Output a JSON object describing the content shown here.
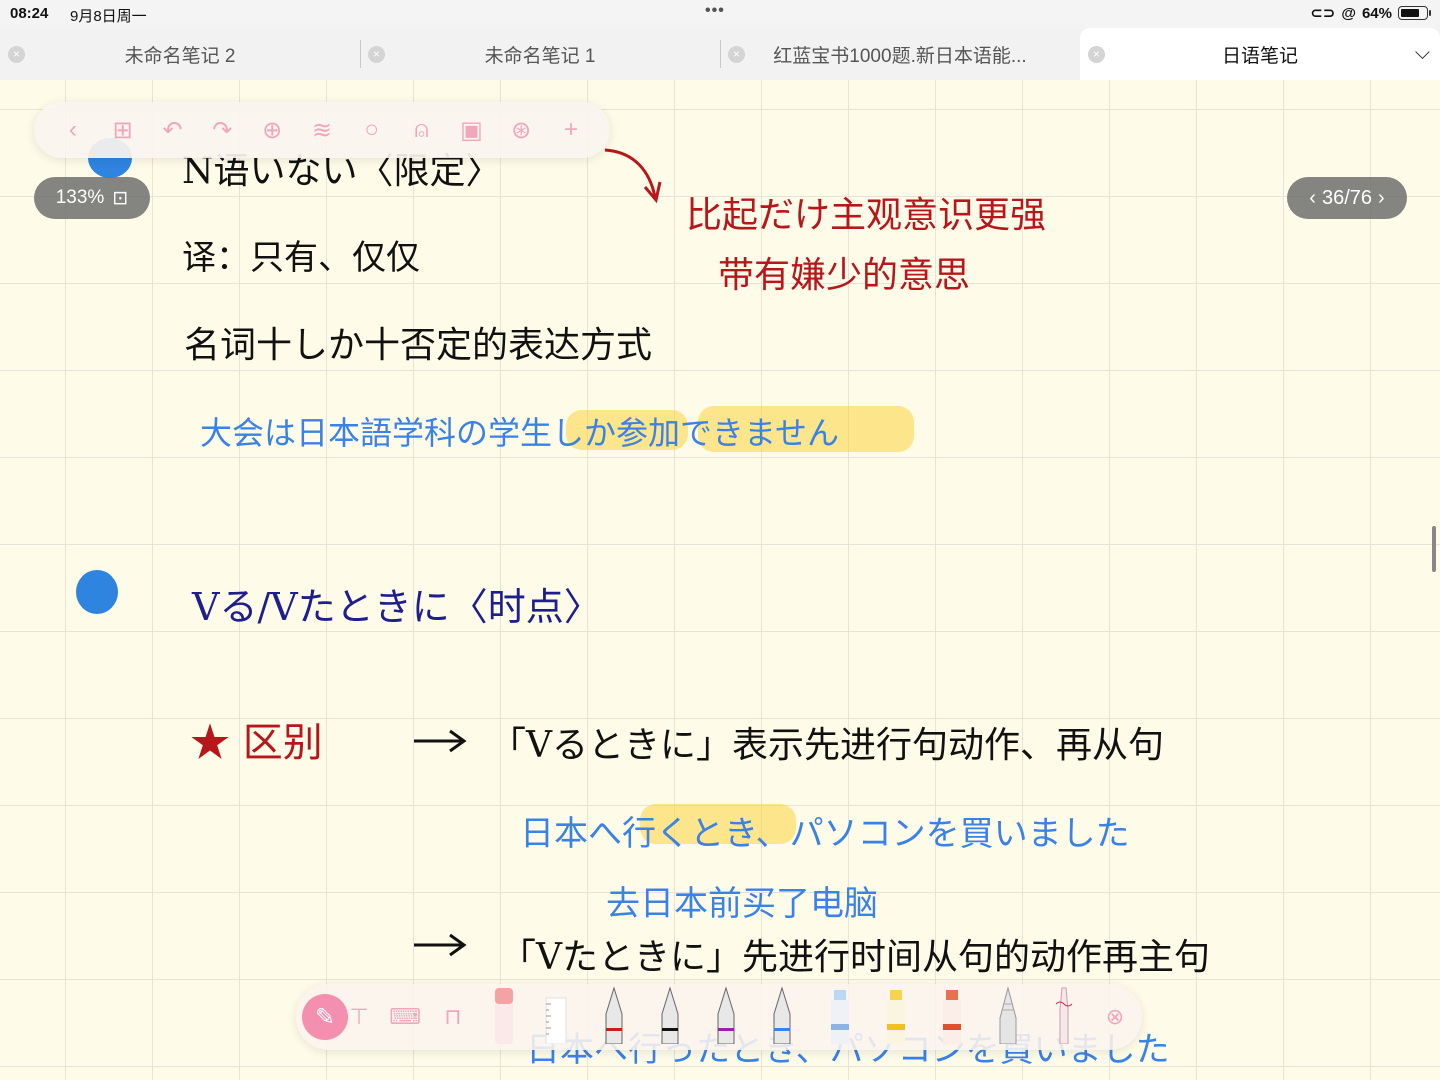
{
  "status_bar": {
    "time": "08:24",
    "date": "9月8日周一",
    "battery": "64%",
    "battery_level": 0.64
  },
  "tabs": [
    {
      "label": "未命名笔记 2",
      "active": false
    },
    {
      "label": "未命名笔记 1",
      "active": false
    },
    {
      "label": "红蓝宝书1000题.新日本语能...",
      "active": false
    },
    {
      "label": "日语笔记",
      "active": true
    }
  ],
  "toolbar_top": {
    "icons": [
      "back-icon",
      "grid-icon",
      "undo-icon",
      "redo-icon",
      "add-page-icon",
      "layers-icon",
      "search-icon",
      "microphone-icon",
      "sticker-icon",
      "globe-icon",
      "plus-icon"
    ]
  },
  "zoom": "133%",
  "page_indicator": "36/76",
  "note": {
    "line_partial_top": "N语いない〈限定〉",
    "translation": "译：只有、仅仅",
    "grammar": "名词十しか十否定的表达方式",
    "example1": "大会は日本語学科の学生しか参加できません",
    "side_note_1": "比起だけ主观意识更强",
    "side_note_2": "带有嫌少的意思",
    "heading2": "Vる/Vたときに〈时点〉",
    "distinction_label": "★ 区别",
    "rule1": "「Vるときに」表示先进行句动作、再从句",
    "example2": "日本へ行くとき、パソコンを買いました",
    "example2_translation": "去日本前买了电脑",
    "rule2": "「Vたときに」先进行时间从句的动作再主句",
    "example3_partial": "日本へ行ったとき、パソコンを買いました"
  },
  "colors": {
    "ink_black": "#111111",
    "ink_red": "#b7161b",
    "ink_blue": "#3b82e6",
    "ink_navy": "#1e1e8c",
    "highlight": "#fad23c",
    "accent_pink": "#f58fb0"
  },
  "toolbar_bottom": {
    "tools": [
      "pen-icon",
      "text-box-icon",
      "keyboard-icon",
      "book-icon",
      "eraser-icon",
      "ruler-icon",
      "fountain-pen-red-icon",
      "fountain-pen-black-icon",
      "fountain-pen-purple-icon",
      "fountain-pen-blue-icon",
      "highlighter-blue-icon",
      "highlighter-yellow-icon",
      "marker-red-icon",
      "pencil-icon",
      "brush-icon",
      "shape-icon"
    ]
  }
}
